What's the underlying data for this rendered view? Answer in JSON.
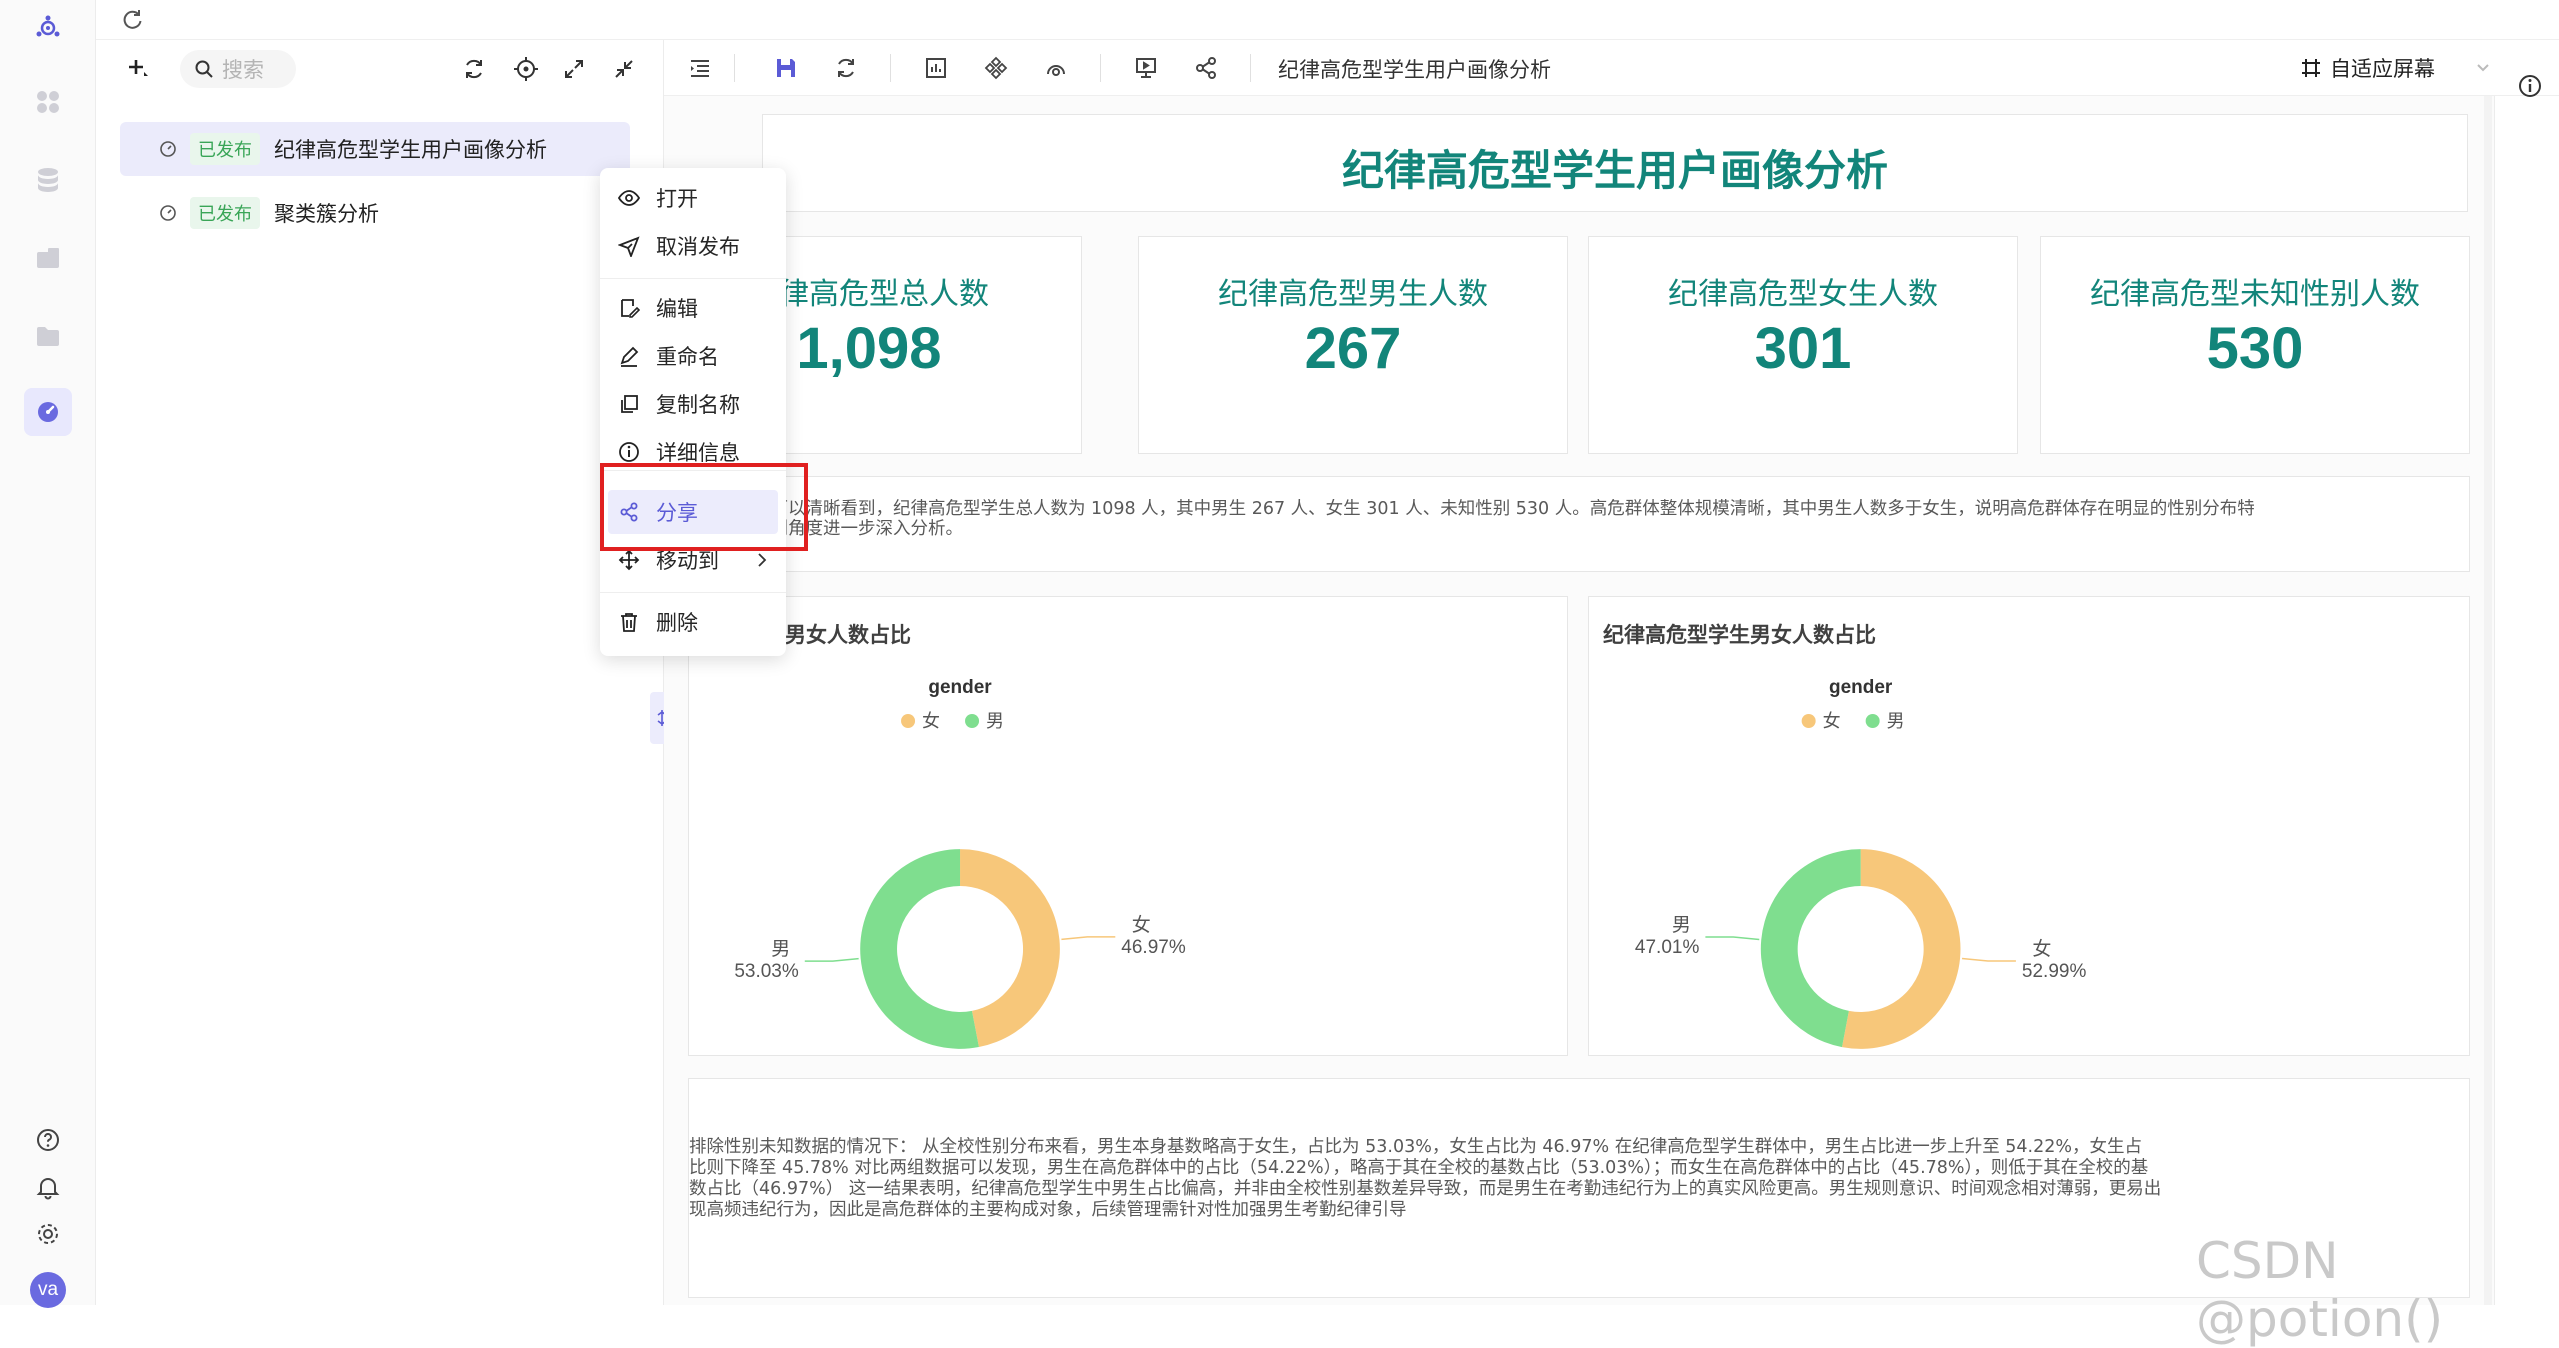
{
  "topbar": {},
  "tree": {
    "search_placeholder": "搜索",
    "items": [
      {
        "status": "已发布",
        "label": "纪律高危型学生用户画像分析"
      },
      {
        "status": "已发布",
        "label": "聚类簇分析"
      }
    ]
  },
  "context_menu": {
    "items": [
      "打开",
      "取消发布",
      "编辑",
      "重命名",
      "复制名称",
      "详细信息",
      "分享",
      "移动到",
      "删除"
    ]
  },
  "toolbar": {
    "doc_title": "纪律高危型学生用户画像分析",
    "fit_screen_label": "自适应屏幕"
  },
  "dashboard": {
    "title": "纪律高危型学生用户画像分析",
    "kpis": [
      {
        "label": "纪律高危型总人数",
        "value": "1,098"
      },
      {
        "label": "纪律高危型男生人数",
        "value": "267"
      },
      {
        "label": "纪律高危型女生人数",
        "value": "301"
      },
      {
        "label": "纪律高危型未知性别人数",
        "value": "530"
      }
    ],
    "summary_line1": "卡可以清晰看到，纪律高危型学生总人数为 1098 人，其中男生 267 人、女生 301 人、未知性别 530 人。高危群体整体规模清晰，其中男生人数多于女生，说明高危群体存在明显的性别分布特",
    "summary_line2": "性别角度进一步深入分析。",
    "analysis_lines": [
      "排除性别未知数据的情况下： 从全校性别分布来看，男生本身基数略高于女生，占比为 53.03%，女生占比为 46.97% 在纪律高危型学生群体中，男生占比进一步上升至 54.22%，女生占",
      "比则下降至 45.78% 对比两组数据可以发现，男生在高危群体中的占比（54.22%），略高于其在全校的基数占比（53.03%）；而女生在高危群体中的占比（45.78%），则低于其在全校的基",
      "数占比（46.97%） 这一结果表明，纪律高危型学生中男生占比偏高，并非由全校性别基数差异导致，而是男生在考勤违纪行为上的真实风险更高。男生规则意识、时间观念相对薄弱，更易出",
      "现高频违纪行为，因此是高危群体的主要构成对象，后续管理需针对性加强男生考勤纪律引导"
    ]
  },
  "chart_data": [
    {
      "type": "pie",
      "title": "男女人数占比",
      "legend_title": "gender",
      "legend_position": "top",
      "categories": [
        "女",
        "男"
      ],
      "values": [
        46.97,
        53.03
      ],
      "labels": [
        "46.97%",
        "53.03%"
      ],
      "colors": [
        "#f7c77a",
        "#7fde8f"
      ]
    },
    {
      "type": "pie",
      "title": "纪律高危型学生男女人数占比",
      "legend_title": "gender",
      "legend_position": "top",
      "categories": [
        "女",
        "男"
      ],
      "values": [
        52.99,
        47.01
      ],
      "labels": [
        "52.99%",
        "47.01%"
      ],
      "colors": [
        "#f7c77a",
        "#7fde8f"
      ]
    }
  ],
  "rail": {
    "avatar_text": "va"
  },
  "watermark": "CSDN @potion()",
  "colors": {
    "accent": "#12857a",
    "brand": "#5b5bd6",
    "highlight_box": "#e02020"
  }
}
